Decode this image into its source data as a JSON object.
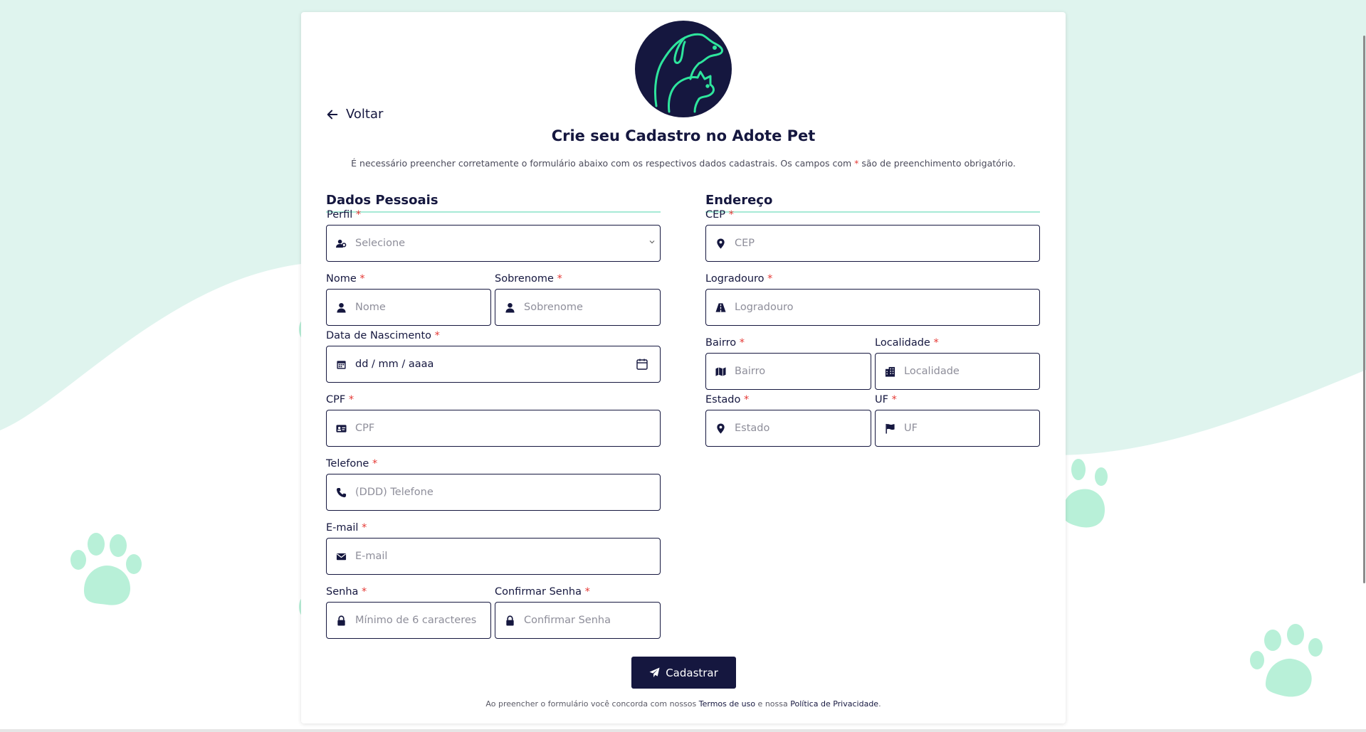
{
  "page": {
    "back_label": "Voltar",
    "title": "Crie seu Cadastro no Adote Pet",
    "subtitle_before": "É necessário preencher corretamente o formulário abaixo com os respectivos dados cadastrais. Os campos com ",
    "subtitle_star": "*",
    "subtitle_after": " são de preenchimento obrigatório."
  },
  "personal": {
    "section_title": "Dados Pessoais",
    "perfil": {
      "label": "Perfil",
      "placeholder": "Selecione"
    },
    "nome": {
      "label": "Nome",
      "placeholder": "Nome"
    },
    "sobrenome": {
      "label": "Sobrenome",
      "placeholder": "Sobrenome"
    },
    "nascimento": {
      "label": "Data de Nascimento",
      "value": "dd / mm / aaaa"
    },
    "cpf": {
      "label": "CPF",
      "placeholder": "CPF"
    },
    "telefone": {
      "label": "Telefone",
      "placeholder": "(DDD) Telefone"
    },
    "email": {
      "label": "E-mail",
      "placeholder": "E-mail"
    },
    "senha": {
      "label": "Senha",
      "placeholder": "Mínimo de 6 caracteres"
    },
    "confirmar_senha": {
      "label": "Confirmar Senha",
      "placeholder": "Confirmar Senha"
    }
  },
  "address": {
    "section_title": "Endereço",
    "cep": {
      "label": "CEP",
      "placeholder": "CEP"
    },
    "logradouro": {
      "label": "Logradouro",
      "placeholder": "Logradouro"
    },
    "bairro": {
      "label": "Bairro",
      "placeholder": "Bairro"
    },
    "localidade": {
      "label": "Localidade",
      "placeholder": "Localidade"
    },
    "estado": {
      "label": "Estado",
      "placeholder": "Estado"
    },
    "uf": {
      "label": "UF",
      "placeholder": "UF"
    }
  },
  "required_mark": "*",
  "submit_label": "Cadastrar",
  "footer": {
    "before": "Ao preencher o formulário você concorda com nossos ",
    "terms": "Termos de uso",
    "middle": " e nossa ",
    "privacy": "Política de Privacidade",
    "after": "."
  },
  "colors": {
    "navy": "#15173f",
    "mint": "#dff4ee",
    "paw": "#b8f0d8",
    "accent_line": "#a7ead6",
    "logo_stroke": "#2ee59d",
    "required": "#e53935"
  },
  "icons": [
    "arrow-left-icon",
    "user-group-icon",
    "user-icon",
    "calendar-icon",
    "id-card-icon",
    "phone-icon",
    "envelope-icon",
    "lock-icon",
    "map-marker-icon",
    "road-icon",
    "map-icon",
    "building-icon",
    "flag-icon",
    "paper-plane-icon",
    "chevron-down-icon"
  ]
}
